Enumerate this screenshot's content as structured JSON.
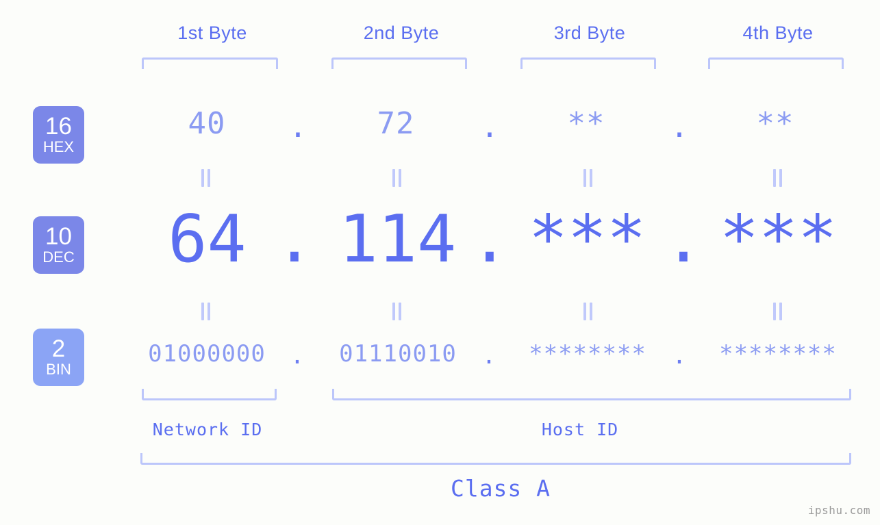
{
  "background_color": "#fcfdfa",
  "accent_color": "#5b6ef0",
  "muted_accent_color": "#8b9bf2",
  "bracket_color": "#bcc6fa",
  "headers": [
    {
      "label": "1st Byte"
    },
    {
      "label": "2nd Byte"
    },
    {
      "label": "3rd Byte"
    },
    {
      "label": "4th Byte"
    }
  ],
  "radix_badges": [
    {
      "base": "16",
      "name": "HEX",
      "color": "#7b87e8"
    },
    {
      "base": "10",
      "name": "DEC",
      "color": "#7b87e8"
    },
    {
      "base": "2",
      "name": "BIN",
      "color": "#8ba4f5"
    }
  ],
  "rows": {
    "hex": {
      "base": "16",
      "values": [
        "40",
        "72",
        "**",
        "**"
      ],
      "separator": "."
    },
    "dec": {
      "base": "10",
      "values": [
        "64",
        "114",
        "***",
        "***"
      ],
      "separator": "."
    },
    "bin": {
      "base": "2",
      "values": [
        "01000000",
        "01110010",
        "********",
        "********"
      ],
      "separator": "."
    }
  },
  "connector_symbol": "||",
  "regions": [
    {
      "label": "Network ID"
    },
    {
      "label": "Host ID"
    }
  ],
  "class": {
    "label": "Class A"
  },
  "watermark": {
    "text": "ipshu.com"
  }
}
